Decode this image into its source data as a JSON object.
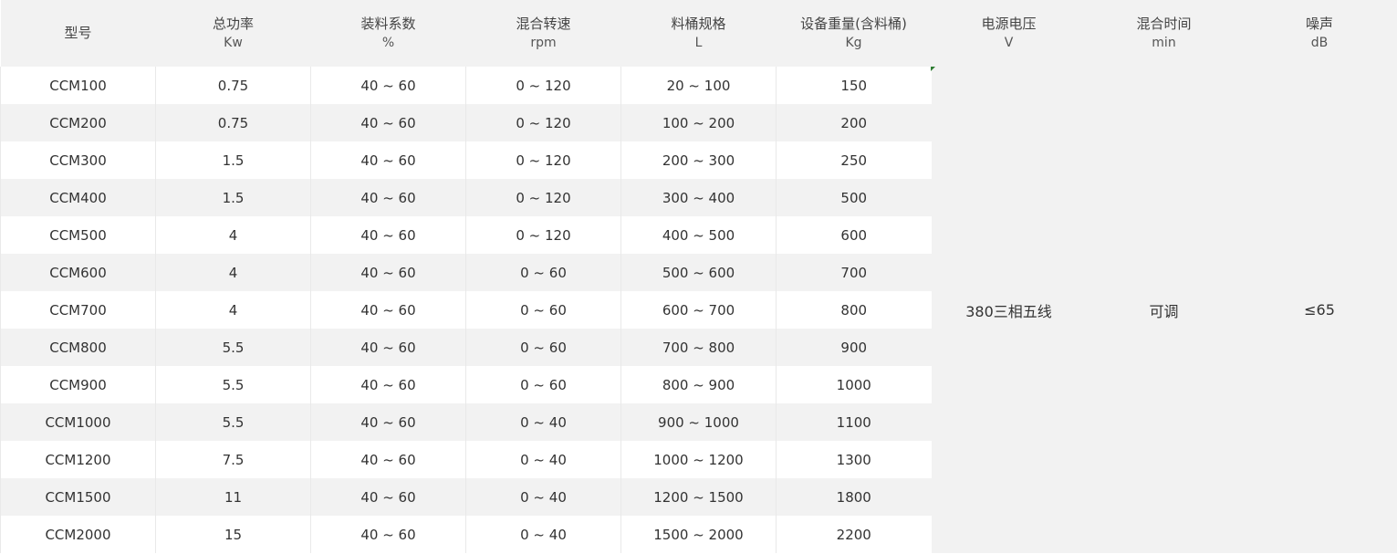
{
  "headers": [
    {
      "name": "型号",
      "unit": ""
    },
    {
      "name": "总功率",
      "unit": "Kw"
    },
    {
      "name": "装料系数",
      "unit": "%"
    },
    {
      "name": "混合转速",
      "unit": "rpm"
    },
    {
      "name": "料桶规格",
      "unit": "L"
    },
    {
      "name": "设备重量(含料桶)",
      "unit": "Kg"
    },
    {
      "name": "电源电压",
      "unit": "V"
    },
    {
      "name": "混合时间",
      "unit": "min"
    },
    {
      "name": "噪声",
      "unit": "dB"
    }
  ],
  "rows": [
    {
      "model": "CCM100",
      "power": "0.75",
      "fill": "40 ~ 60",
      "speed": "0 ~ 120",
      "bucket": "20 ~ 100",
      "weight": "150"
    },
    {
      "model": "CCM200",
      "power": "0.75",
      "fill": "40 ~ 60",
      "speed": "0 ~ 120",
      "bucket": "100 ~ 200",
      "weight": "200"
    },
    {
      "model": "CCM300",
      "power": "1.5",
      "fill": "40 ~ 60",
      "speed": "0 ~ 120",
      "bucket": "200 ~ 300",
      "weight": "250"
    },
    {
      "model": "CCM400",
      "power": "1.5",
      "fill": "40 ~ 60",
      "speed": "0 ~ 120",
      "bucket": "300 ~ 400",
      "weight": "500"
    },
    {
      "model": "CCM500",
      "power": "4",
      "fill": "40 ~ 60",
      "speed": "0 ~ 120",
      "bucket": "400 ~ 500",
      "weight": "600"
    },
    {
      "model": "CCM600",
      "power": "4",
      "fill": "40 ~ 60",
      "speed": "0 ~ 60",
      "bucket": "500 ~ 600",
      "weight": "700"
    },
    {
      "model": "CCM700",
      "power": "4",
      "fill": "40 ~ 60",
      "speed": "0 ~ 60",
      "bucket": "600 ~ 700",
      "weight": "800"
    },
    {
      "model": "CCM800",
      "power": "5.5",
      "fill": "40 ~ 60",
      "speed": "0 ~ 60",
      "bucket": "700 ~ 800",
      "weight": "900"
    },
    {
      "model": "CCM900",
      "power": "5.5",
      "fill": "40 ~ 60",
      "speed": "0 ~ 60",
      "bucket": "800 ~ 900",
      "weight": "1000"
    },
    {
      "model": "CCM1000",
      "power": "5.5",
      "fill": "40 ~ 60",
      "speed": "0 ~ 40",
      "bucket": "900 ~ 1000",
      "weight": "1100"
    },
    {
      "model": "CCM1200",
      "power": "7.5",
      "fill": "40 ~ 60",
      "speed": "0 ~ 40",
      "bucket": "1000 ~ 1200",
      "weight": "1300"
    },
    {
      "model": "CCM1500",
      "power": "11",
      "fill": "40 ~ 60",
      "speed": "0 ~ 40",
      "bucket": "1200 ~ 1500",
      "weight": "1800"
    },
    {
      "model": "CCM2000",
      "power": "15",
      "fill": "40 ~ 60",
      "speed": "0 ~ 40",
      "bucket": "1500 ~ 2000",
      "weight": "2200"
    }
  ],
  "shared": {
    "voltage": "380三相五线",
    "mix_time": "可调",
    "noise": "≤65"
  }
}
